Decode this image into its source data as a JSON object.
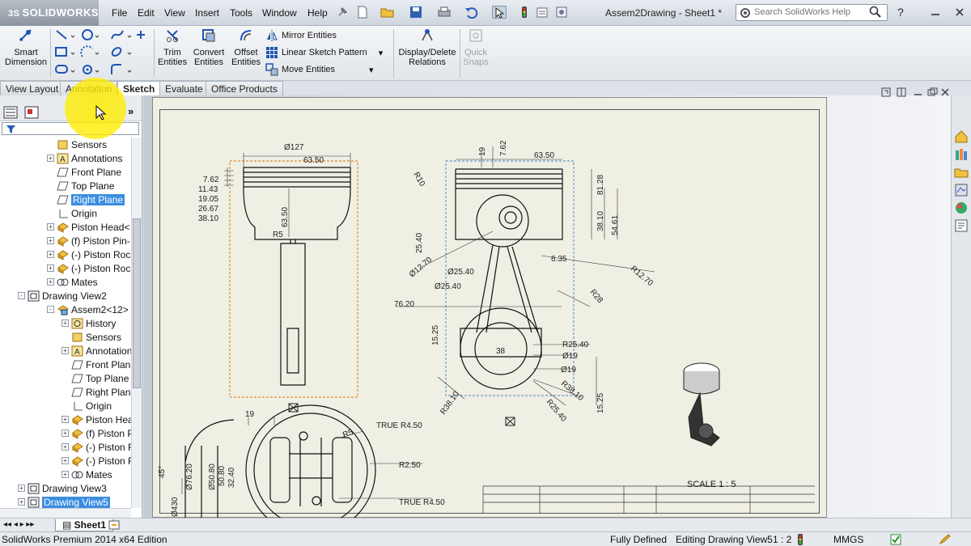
{
  "app": {
    "logo": "SOLIDWORKS",
    "menus": [
      "File",
      "Edit",
      "View",
      "Insert",
      "Tools",
      "Window",
      "Help"
    ],
    "document_title": "Assem2Drawing - Sheet1 *",
    "search_placeholder": "Search SolidWorks Help"
  },
  "commands": {
    "smart_dimension": "Smart Dimension",
    "trim": "Trim Entities",
    "convert": "Convert Entities",
    "offset": "Offset Entities",
    "mirror": "Mirror Entities",
    "linear_pattern": "Linear Sketch Pattern",
    "move": "Move Entities",
    "display_delete": "Display/Delete Relations",
    "quick_snaps": "Quick Snaps"
  },
  "tabs": [
    "View Layout",
    "Annotation",
    "Sketch",
    "Evaluate",
    "Office Products"
  ],
  "active_tab": "Sketch",
  "tree": [
    {
      "label": "Sensors",
      "icon": "sensors-icon",
      "indent": 1,
      "exp": ""
    },
    {
      "label": "Annotations",
      "icon": "annotations-icon",
      "indent": 1,
      "exp": "+"
    },
    {
      "label": "Front Plane",
      "icon": "plane-icon",
      "indent": 1,
      "exp": ""
    },
    {
      "label": "Top Plane",
      "icon": "plane-icon",
      "indent": 1,
      "exp": ""
    },
    {
      "label": "Right Plane",
      "icon": "plane-icon",
      "indent": 1,
      "exp": "",
      "selected": true
    },
    {
      "label": "Origin",
      "icon": "origin-icon",
      "indent": 1,
      "exp": ""
    },
    {
      "label": "Piston Head<",
      "icon": "part-icon",
      "indent": 1,
      "exp": "+"
    },
    {
      "label": "(f) Piston Pin-",
      "icon": "part-icon",
      "indent": 1,
      "exp": "+"
    },
    {
      "label": "(-) Piston Roc",
      "icon": "part-icon",
      "indent": 1,
      "exp": "+"
    },
    {
      "label": "(-) Piston Roc",
      "icon": "part-icon",
      "indent": 1,
      "exp": "+"
    },
    {
      "label": "Mates",
      "icon": "mates-icon",
      "indent": 1,
      "exp": "+"
    },
    {
      "label": "Drawing View2",
      "icon": "drawing-view-icon",
      "indent": 0,
      "exp": "-"
    },
    {
      "label": "Assem2<12>",
      "icon": "assembly-icon",
      "indent": 1,
      "exp": "-"
    },
    {
      "label": "History",
      "icon": "history-icon",
      "indent": 2,
      "exp": "+"
    },
    {
      "label": "Sensors",
      "icon": "sensors-icon",
      "indent": 2,
      "exp": ""
    },
    {
      "label": "Annotations",
      "icon": "annotations-icon",
      "indent": 2,
      "exp": "+"
    },
    {
      "label": "Front Plane",
      "icon": "plane-icon",
      "indent": 2,
      "exp": ""
    },
    {
      "label": "Top Plane",
      "icon": "plane-icon",
      "indent": 2,
      "exp": ""
    },
    {
      "label": "Right Plane",
      "icon": "plane-icon",
      "indent": 2,
      "exp": ""
    },
    {
      "label": "Origin",
      "icon": "origin-icon",
      "indent": 2,
      "exp": ""
    },
    {
      "label": "Piston Head<",
      "icon": "part-icon",
      "indent": 2,
      "exp": "+"
    },
    {
      "label": "(f) Piston Pin-",
      "icon": "part-icon",
      "indent": 2,
      "exp": "+"
    },
    {
      "label": "(-) Piston Roc",
      "icon": "part-icon",
      "indent": 2,
      "exp": "+"
    },
    {
      "label": "(-) Piston Roc",
      "icon": "part-icon",
      "indent": 2,
      "exp": "+"
    },
    {
      "label": "Mates",
      "icon": "mates-icon",
      "indent": 2,
      "exp": "+"
    },
    {
      "label": "Drawing View3",
      "icon": "drawing-view-icon",
      "indent": 0,
      "exp": "+"
    },
    {
      "label": "Drawing View5",
      "icon": "drawing-view-icon",
      "indent": 0,
      "exp": "+",
      "selected": true
    }
  ],
  "drawing": {
    "dims_front": [
      "Ø127",
      "63.50",
      "7.62",
      "11.43",
      "19.05",
      "26.67",
      "38.10",
      "63.50",
      "R5"
    ],
    "dims_side": [
      "19",
      "7.62",
      "63.50",
      "R10",
      "81.28",
      "38.10",
      "54.61",
      "25.40",
      "Ø12.70",
      "Ø25.40",
      "Ø25.40",
      "6.35",
      "R12.70",
      "76.20",
      "R28",
      "15.25",
      "38",
      "R25.40",
      "Ø19",
      "Ø19",
      "R38.10",
      "R38.10",
      "R25.40",
      "15.25"
    ],
    "dims_bottom": [
      "19",
      "R5",
      "TRUE R4.50",
      "R2.50",
      "TRUE R4.50",
      "45°",
      "Ø76.20",
      "50.80",
      "Ø50.80",
      "32.40",
      "Ø430"
    ],
    "scale": "SCALE 1 : 5"
  },
  "sheet_tab": "Sheet1",
  "status": {
    "edition": "SolidWorks Premium 2014 x64 Edition",
    "state": "Fully Defined",
    "editing": "Editing Drawing View5",
    "scale": "1 : 2",
    "units": "MMGS"
  },
  "colors": {
    "accent": "#3a8de0",
    "highlight": "#ffec00",
    "sheet": "#f0efe4"
  }
}
